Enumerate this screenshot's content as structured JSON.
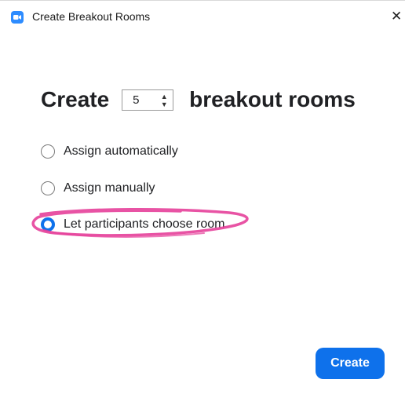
{
  "window": {
    "title": "Create Breakout Rooms",
    "close_symbol": "✕",
    "app_icon": "zoom-camera-icon"
  },
  "form": {
    "prefix": "Create",
    "room_count": "5",
    "suffix": "breakout rooms",
    "spin_up": "▲",
    "spin_down": "▼",
    "options": [
      {
        "label": "Assign automatically",
        "checked": false
      },
      {
        "label": "Assign manually",
        "checked": false
      },
      {
        "label": "Let participants choose room",
        "checked": true
      }
    ]
  },
  "actions": {
    "create_label": "Create"
  },
  "colors": {
    "accent": "#0e71eb",
    "annotation": "#e6409a",
    "app_icon": "#2d8cff"
  }
}
